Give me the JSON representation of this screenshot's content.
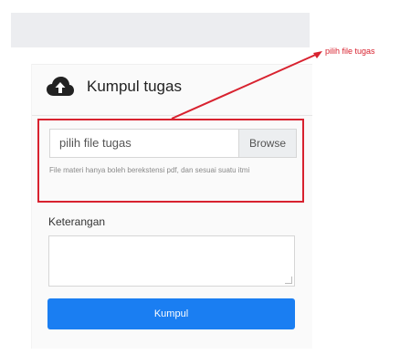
{
  "card": {
    "title": "Kumpul tugas",
    "icon": "cloud-upload-icon"
  },
  "file_input": {
    "placeholder": "pilih file tugas",
    "browse_label": "Browse",
    "help_text": "File materi hanya boleh berekstensi pdf, dan sesuai suatu itmi"
  },
  "notes": {
    "label": "Keterangan",
    "value": ""
  },
  "submit": {
    "label": "Kumpul"
  },
  "annotation": {
    "label": "pilih file tugas",
    "color": "#d8222f"
  },
  "colors": {
    "accent": "#1a7ef2",
    "annotation": "#d8222f"
  }
}
